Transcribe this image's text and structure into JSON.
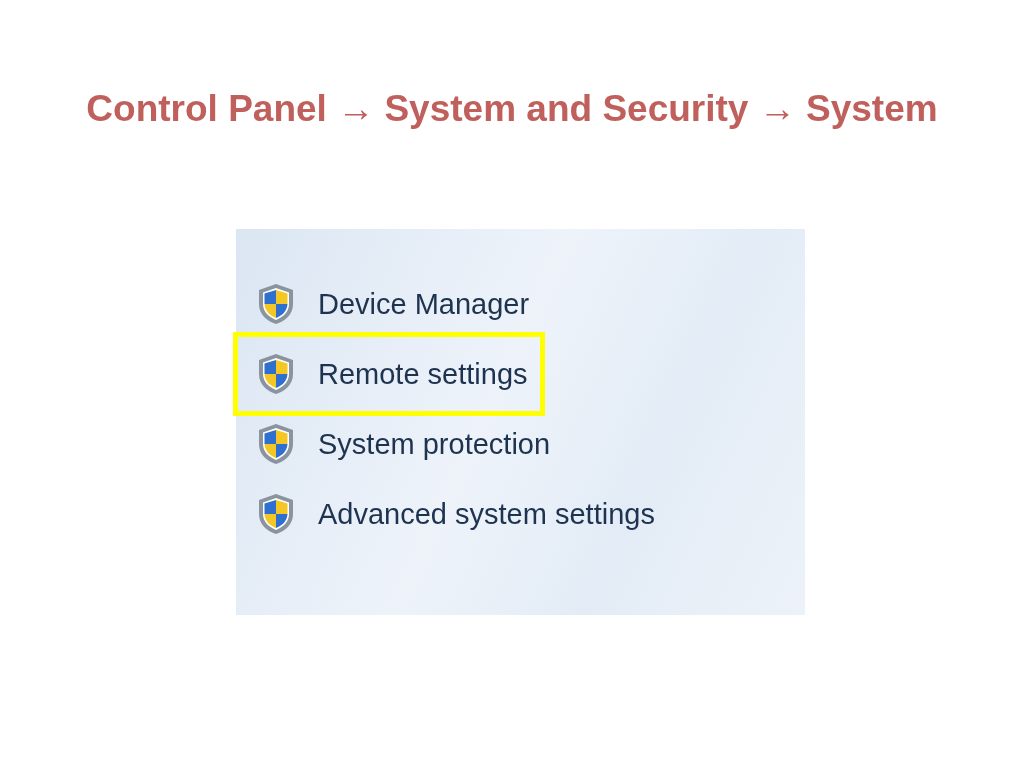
{
  "slide": {
    "title": "Control Panel → System and Security → System"
  },
  "links": [
    {
      "label": "Device Manager",
      "highlighted": false
    },
    {
      "label": "Remote settings",
      "highlighted": true
    },
    {
      "label": "System protection",
      "highlighted": false
    },
    {
      "label": "Advanced system settings",
      "highlighted": false
    }
  ]
}
